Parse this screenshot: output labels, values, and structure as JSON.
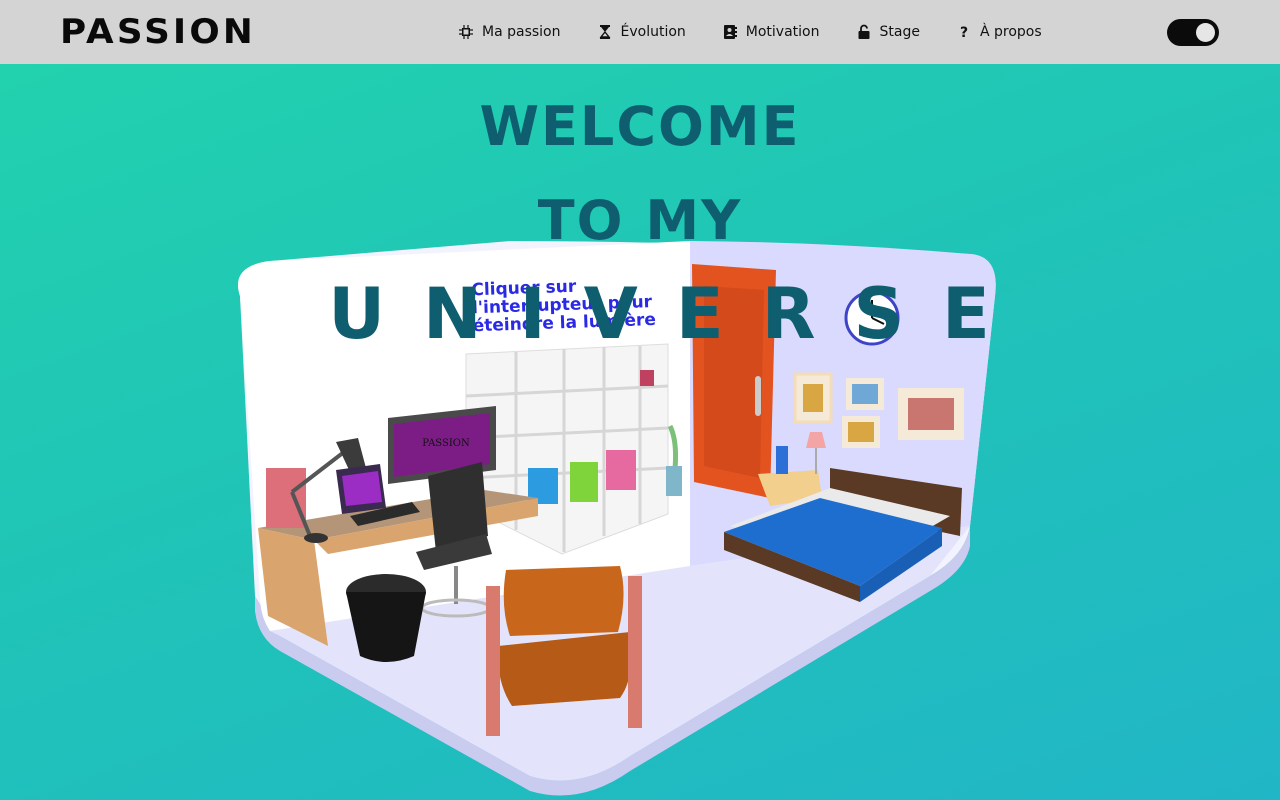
{
  "header": {
    "logo": "PASSION",
    "nav": [
      {
        "label": "Ma passion",
        "icon": "chip-icon"
      },
      {
        "label": "Évolution",
        "icon": "hourglass-icon"
      },
      {
        "label": "Motivation",
        "icon": "contact-book-icon"
      },
      {
        "label": "Stage",
        "icon": "lock-open-icon"
      },
      {
        "label": "À propos",
        "icon": "question-icon"
      }
    ],
    "theme_toggle": {
      "state": "on"
    }
  },
  "hero": {
    "line1": "WELCOME",
    "line2": "TO MY",
    "line3": "UNIVERSE"
  },
  "scene": {
    "hint": "Cliquer sur l'interrupteur pour éteindre la lumière",
    "monitor_text": "PASSION"
  },
  "colors": {
    "header_bg": "#d4d4d4",
    "page_gradient_start": "#22d3ad",
    "page_gradient_end": "#21b6c7",
    "title_color": "#0e5e70",
    "hint_color": "#2a2ae6"
  }
}
